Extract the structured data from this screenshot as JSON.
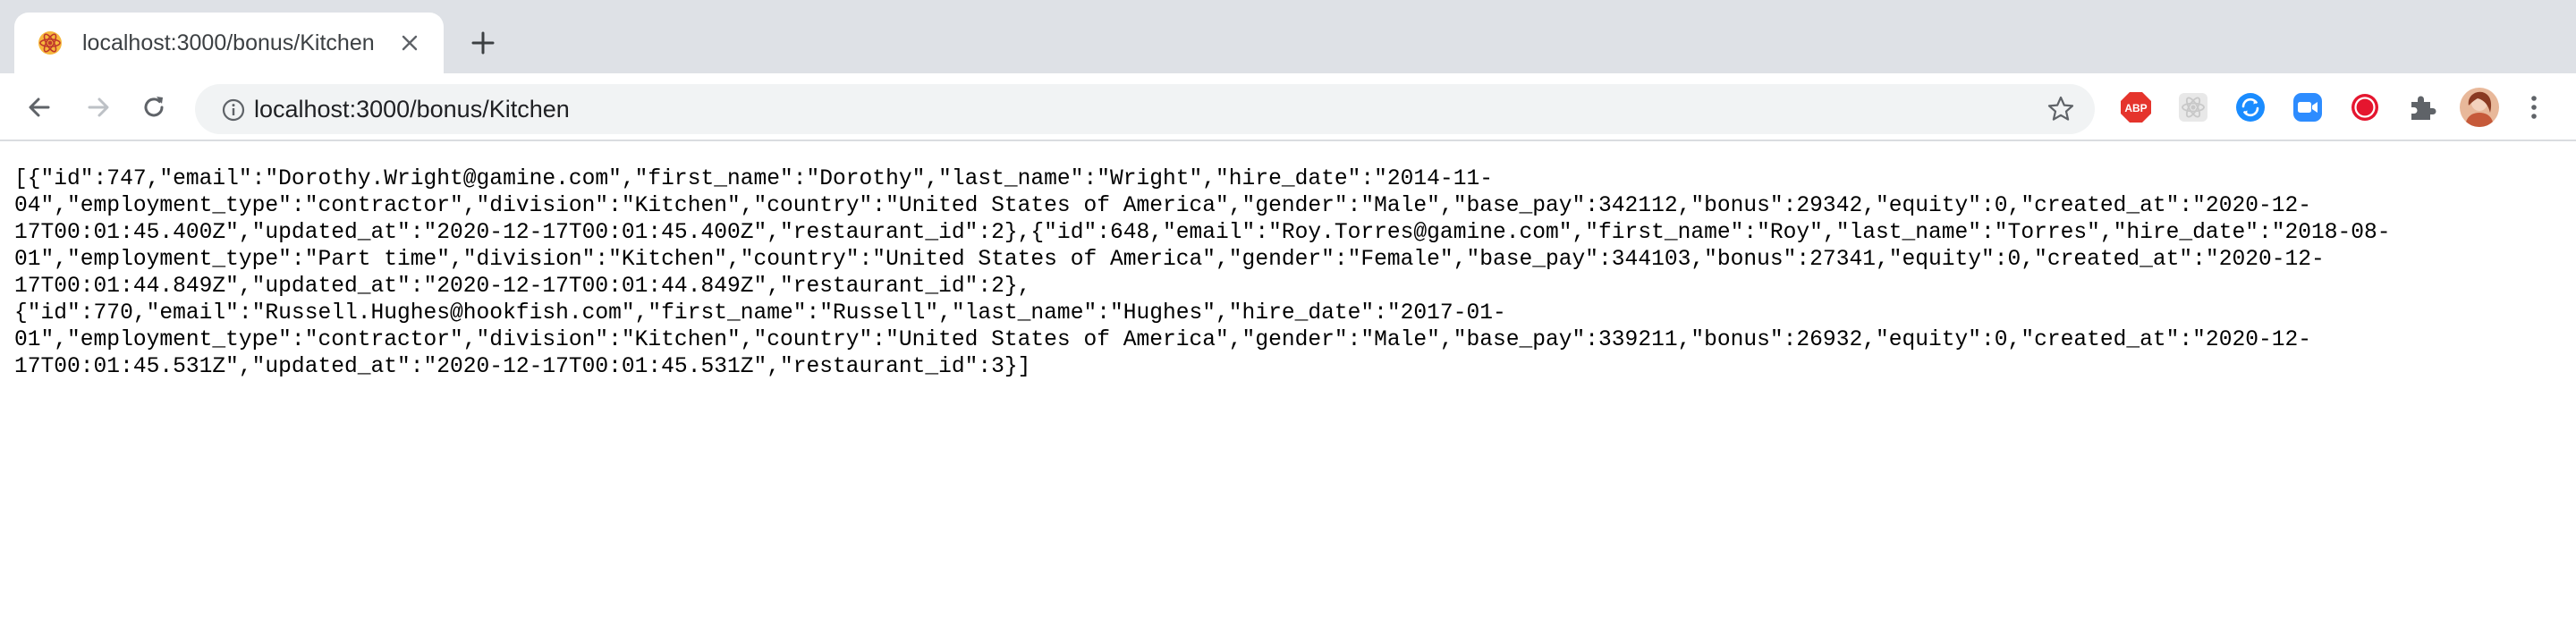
{
  "tab": {
    "title": "localhost:3000/bonus/Kitchen",
    "favicon": "react-atom-favicon-icon"
  },
  "toolbar": {
    "url": "localhost:3000/bonus/Kitchen",
    "icons": [
      "back-arrow-icon",
      "forward-arrow-icon",
      "reload-icon",
      "info-icon",
      "star-icon"
    ],
    "extensions": [
      {
        "name": "adblock-plus-icon",
        "label": "ABP",
        "color": "#e5342c"
      },
      {
        "name": "react-devtools-icon",
        "color": "#d0d0d0"
      },
      {
        "name": "sync-extension-icon",
        "color": "#1a8cff"
      },
      {
        "name": "zoom-extension-icon",
        "color": "#2d8cff"
      },
      {
        "name": "record-extension-icon",
        "color": "#e5162f"
      },
      {
        "name": "puzzle-extensions-icon",
        "color": "#5f6368"
      },
      {
        "name": "profile-avatar",
        "color": "#d9744d"
      },
      {
        "name": "kebab-menu-icon",
        "color": "#5f6368"
      }
    ]
  },
  "page": {
    "lines": [
      "[{\"id\":747,\"email\":\"Dorothy.Wright@gamine.com\",\"first_name\":\"Dorothy\",\"last_name\":\"Wright\",\"hire_date\":\"2014-11-",
      "04\",\"employment_type\":\"contractor\",\"division\":\"Kitchen\",\"country\":\"United States of America\",\"gender\":\"Male\",\"base_pay\":342112,\"bonus\":29342,\"equity\":0,\"created_at\":\"2020-12-",
      "17T00:01:45.400Z\",\"updated_at\":\"2020-12-17T00:01:45.400Z\",\"restaurant_id\":2},{\"id\":648,\"email\":\"Roy.Torres@gamine.com\",\"first_name\":\"Roy\",\"last_name\":\"Torres\",\"hire_date\":\"2018-08-",
      "01\",\"employment_type\":\"Part time\",\"division\":\"Kitchen\",\"country\":\"United States of America\",\"gender\":\"Female\",\"base_pay\":344103,\"bonus\":27341,\"equity\":0,\"created_at\":\"2020-12-",
      "17T00:01:44.849Z\",\"updated_at\":\"2020-12-17T00:01:44.849Z\",\"restaurant_id\":2},",
      "{\"id\":770,\"email\":\"Russell.Hughes@hookfish.com\",\"first_name\":\"Russell\",\"last_name\":\"Hughes\",\"hire_date\":\"2017-01-",
      "01\",\"employment_type\":\"contractor\",\"division\":\"Kitchen\",\"country\":\"United States of America\",\"gender\":\"Male\",\"base_pay\":339211,\"bonus\":26932,\"equity\":0,\"created_at\":\"2020-12-",
      "17T00:01:45.531Z\",\"updated_at\":\"2020-12-17T00:01:45.531Z\",\"restaurant_id\":3}]"
    ]
  }
}
